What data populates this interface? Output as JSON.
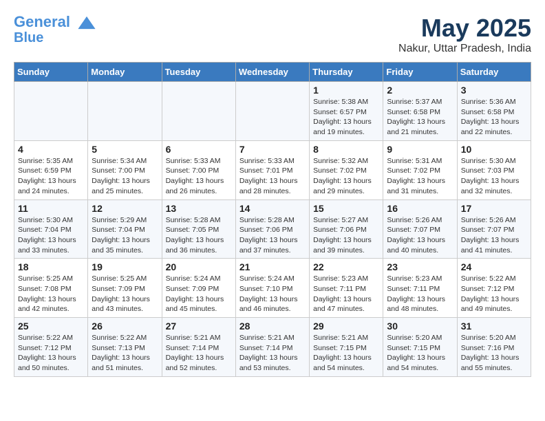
{
  "header": {
    "logo_line1": "General",
    "logo_line2": "Blue",
    "month": "May 2025",
    "location": "Nakur, Uttar Pradesh, India"
  },
  "weekdays": [
    "Sunday",
    "Monday",
    "Tuesday",
    "Wednesday",
    "Thursday",
    "Friday",
    "Saturday"
  ],
  "weeks": [
    [
      {
        "day": "",
        "info": ""
      },
      {
        "day": "",
        "info": ""
      },
      {
        "day": "",
        "info": ""
      },
      {
        "day": "",
        "info": ""
      },
      {
        "day": "1",
        "info": "Sunrise: 5:38 AM\nSunset: 6:57 PM\nDaylight: 13 hours\nand 19 minutes."
      },
      {
        "day": "2",
        "info": "Sunrise: 5:37 AM\nSunset: 6:58 PM\nDaylight: 13 hours\nand 21 minutes."
      },
      {
        "day": "3",
        "info": "Sunrise: 5:36 AM\nSunset: 6:58 PM\nDaylight: 13 hours\nand 22 minutes."
      }
    ],
    [
      {
        "day": "4",
        "info": "Sunrise: 5:35 AM\nSunset: 6:59 PM\nDaylight: 13 hours\nand 24 minutes."
      },
      {
        "day": "5",
        "info": "Sunrise: 5:34 AM\nSunset: 7:00 PM\nDaylight: 13 hours\nand 25 minutes."
      },
      {
        "day": "6",
        "info": "Sunrise: 5:33 AM\nSunset: 7:00 PM\nDaylight: 13 hours\nand 26 minutes."
      },
      {
        "day": "7",
        "info": "Sunrise: 5:33 AM\nSunset: 7:01 PM\nDaylight: 13 hours\nand 28 minutes."
      },
      {
        "day": "8",
        "info": "Sunrise: 5:32 AM\nSunset: 7:02 PM\nDaylight: 13 hours\nand 29 minutes."
      },
      {
        "day": "9",
        "info": "Sunrise: 5:31 AM\nSunset: 7:02 PM\nDaylight: 13 hours\nand 31 minutes."
      },
      {
        "day": "10",
        "info": "Sunrise: 5:30 AM\nSunset: 7:03 PM\nDaylight: 13 hours\nand 32 minutes."
      }
    ],
    [
      {
        "day": "11",
        "info": "Sunrise: 5:30 AM\nSunset: 7:04 PM\nDaylight: 13 hours\nand 33 minutes."
      },
      {
        "day": "12",
        "info": "Sunrise: 5:29 AM\nSunset: 7:04 PM\nDaylight: 13 hours\nand 35 minutes."
      },
      {
        "day": "13",
        "info": "Sunrise: 5:28 AM\nSunset: 7:05 PM\nDaylight: 13 hours\nand 36 minutes."
      },
      {
        "day": "14",
        "info": "Sunrise: 5:28 AM\nSunset: 7:06 PM\nDaylight: 13 hours\nand 37 minutes."
      },
      {
        "day": "15",
        "info": "Sunrise: 5:27 AM\nSunset: 7:06 PM\nDaylight: 13 hours\nand 39 minutes."
      },
      {
        "day": "16",
        "info": "Sunrise: 5:26 AM\nSunset: 7:07 PM\nDaylight: 13 hours\nand 40 minutes."
      },
      {
        "day": "17",
        "info": "Sunrise: 5:26 AM\nSunset: 7:07 PM\nDaylight: 13 hours\nand 41 minutes."
      }
    ],
    [
      {
        "day": "18",
        "info": "Sunrise: 5:25 AM\nSunset: 7:08 PM\nDaylight: 13 hours\nand 42 minutes."
      },
      {
        "day": "19",
        "info": "Sunrise: 5:25 AM\nSunset: 7:09 PM\nDaylight: 13 hours\nand 43 minutes."
      },
      {
        "day": "20",
        "info": "Sunrise: 5:24 AM\nSunset: 7:09 PM\nDaylight: 13 hours\nand 45 minutes."
      },
      {
        "day": "21",
        "info": "Sunrise: 5:24 AM\nSunset: 7:10 PM\nDaylight: 13 hours\nand 46 minutes."
      },
      {
        "day": "22",
        "info": "Sunrise: 5:23 AM\nSunset: 7:11 PM\nDaylight: 13 hours\nand 47 minutes."
      },
      {
        "day": "23",
        "info": "Sunrise: 5:23 AM\nSunset: 7:11 PM\nDaylight: 13 hours\nand 48 minutes."
      },
      {
        "day": "24",
        "info": "Sunrise: 5:22 AM\nSunset: 7:12 PM\nDaylight: 13 hours\nand 49 minutes."
      }
    ],
    [
      {
        "day": "25",
        "info": "Sunrise: 5:22 AM\nSunset: 7:12 PM\nDaylight: 13 hours\nand 50 minutes."
      },
      {
        "day": "26",
        "info": "Sunrise: 5:22 AM\nSunset: 7:13 PM\nDaylight: 13 hours\nand 51 minutes."
      },
      {
        "day": "27",
        "info": "Sunrise: 5:21 AM\nSunset: 7:14 PM\nDaylight: 13 hours\nand 52 minutes."
      },
      {
        "day": "28",
        "info": "Sunrise: 5:21 AM\nSunset: 7:14 PM\nDaylight: 13 hours\nand 53 minutes."
      },
      {
        "day": "29",
        "info": "Sunrise: 5:21 AM\nSunset: 7:15 PM\nDaylight: 13 hours\nand 54 minutes."
      },
      {
        "day": "30",
        "info": "Sunrise: 5:20 AM\nSunset: 7:15 PM\nDaylight: 13 hours\nand 54 minutes."
      },
      {
        "day": "31",
        "info": "Sunrise: 5:20 AM\nSunset: 7:16 PM\nDaylight: 13 hours\nand 55 minutes."
      }
    ]
  ]
}
